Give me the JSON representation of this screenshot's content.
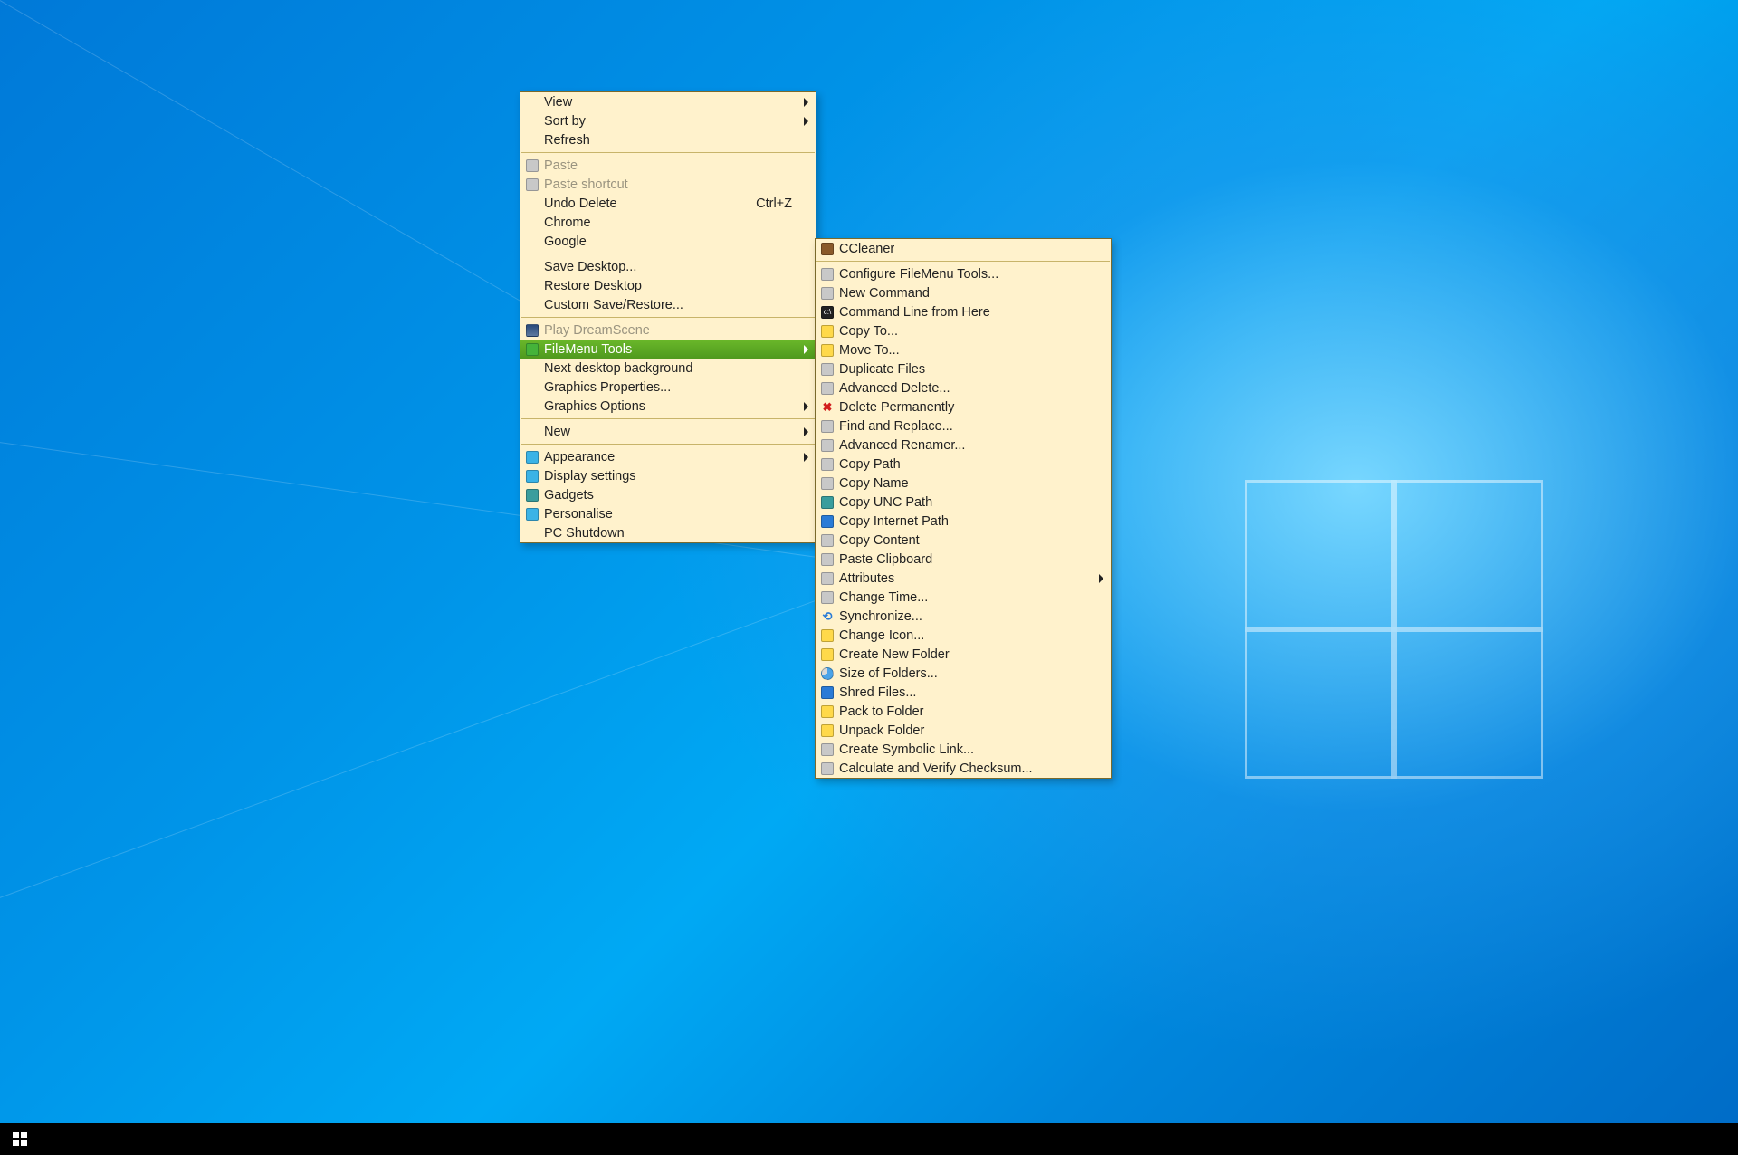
{
  "main_menu": {
    "view": "View",
    "sortby": "Sort by",
    "refresh": "Refresh",
    "paste": "Paste",
    "paste_shortcut": "Paste shortcut",
    "undo_delete": "Undo Delete",
    "undo_delete_shortcut": "Ctrl+Z",
    "chrome": "Chrome",
    "google": "Google",
    "save_desktop": "Save Desktop...",
    "restore_desktop": "Restore Desktop",
    "custom_save": "Custom Save/Restore...",
    "play_dreamscene": "Play DreamScene",
    "filemenu_tools": "FileMenu Tools",
    "next_bg": "Next desktop background",
    "gfx_props": "Graphics Properties...",
    "gfx_opts": "Graphics Options",
    "new": "New",
    "appearance": "Appearance",
    "display_settings": "Display settings",
    "gadgets": "Gadgets",
    "personalise": "Personalise",
    "pc_shutdown": "PC Shutdown"
  },
  "sub_menu": {
    "ccleaner": "CCleaner",
    "configure": "Configure FileMenu Tools...",
    "new_cmd": "New Command",
    "cmd_line": "Command Line from Here",
    "copy_to": "Copy To...",
    "move_to": "Move To...",
    "dup_files": "Duplicate Files",
    "adv_delete": "Advanced Delete...",
    "del_perm": "Delete Permanently",
    "find_replace": "Find and Replace...",
    "adv_rename": "Advanced Renamer...",
    "copy_path": "Copy Path",
    "copy_name": "Copy Name",
    "copy_unc": "Copy UNC Path",
    "copy_internet": "Copy Internet Path",
    "copy_content": "Copy Content",
    "paste_clip": "Paste Clipboard",
    "attributes": "Attributes",
    "change_time": "Change Time...",
    "synchronize": "Synchronize...",
    "change_icon": "Change Icon...",
    "create_folder": "Create New Folder",
    "size_folders": "Size of Folders...",
    "shred": "Shred Files...",
    "pack": "Pack to Folder",
    "unpack": "Unpack Folder",
    "symlink": "Create Symbolic Link...",
    "checksum": "Calculate and Verify Checksum..."
  }
}
